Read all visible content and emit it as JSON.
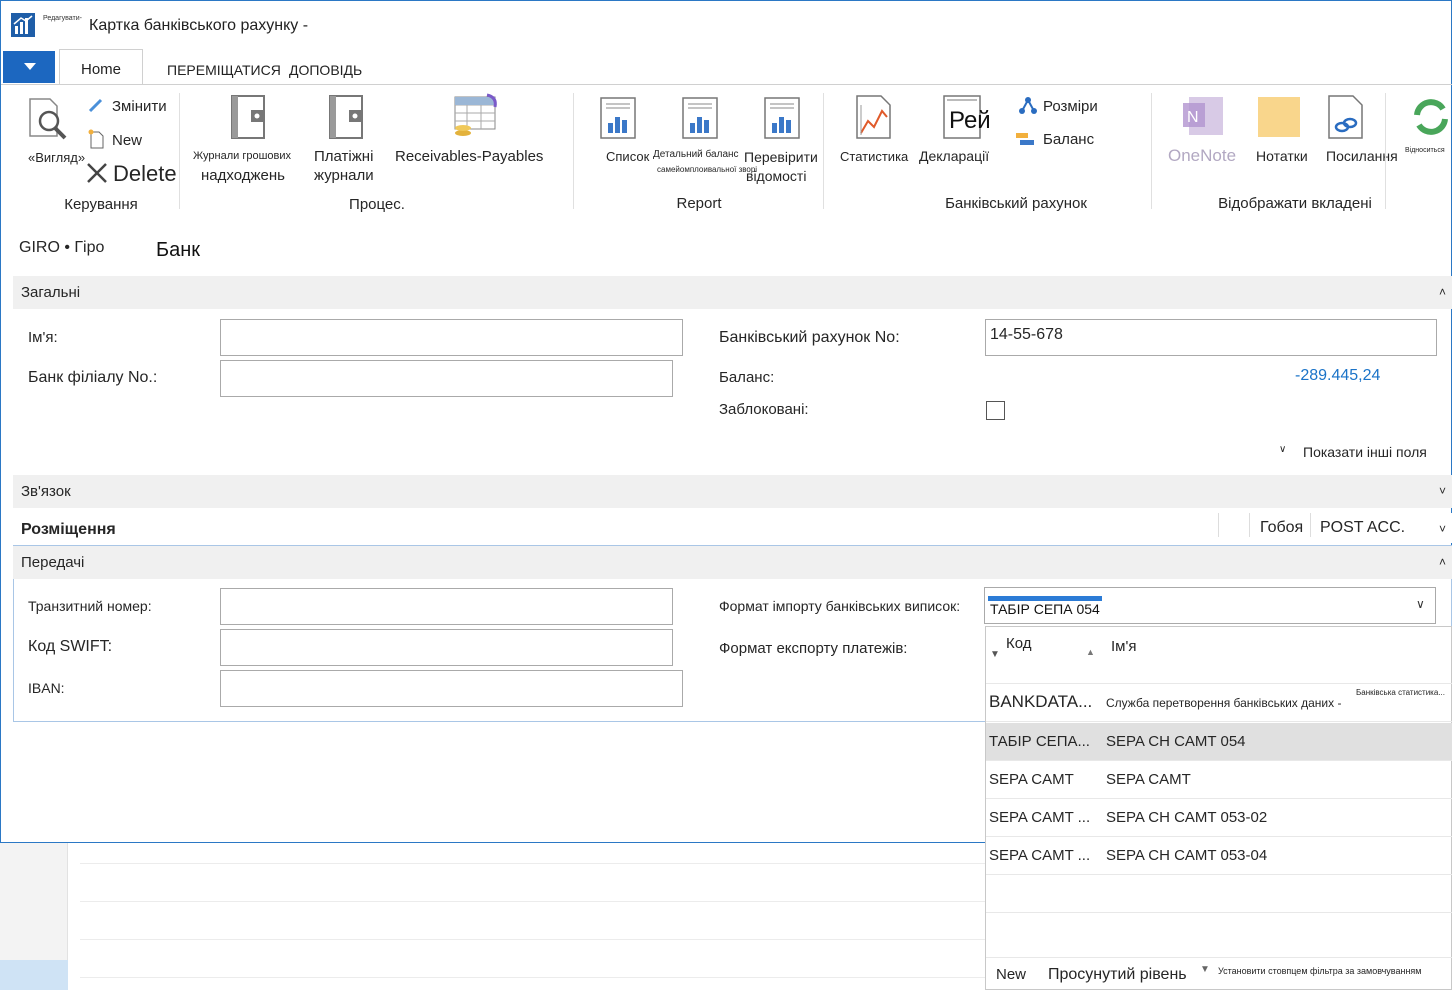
{
  "window": {
    "title": "Картка банківського рахунку -",
    "edit_tag": "Редагувати-"
  },
  "tabs": {
    "home": "Home",
    "navigate": "ПЕРЕМІЩАТИСЯ",
    "report": "ДОПОВІДЬ"
  },
  "ribbon": {
    "view": "«Вигляд»",
    "edit": "Змінити",
    "new": "New",
    "delete": "Delete",
    "group_manage": "Керування",
    "cash_receipt_line1": "Журнали грошових",
    "cash_receipt_line2": "надходжень",
    "payment_line1": "Платіжні",
    "payment_line2": "журнали",
    "receivables_payables": "Receivables-Payables",
    "group_process": "Процес.",
    "list": "Список",
    "detail_trial_line1": "Детальний баланс",
    "detail_trial_line2": "самейомплоивальної зворі",
    "check_line1": "Перевірити",
    "check_line2": "відомості",
    "group_report": "Report",
    "statistics": "Статистика",
    "rei": "Рей",
    "statements": "Декларації",
    "dimensions": "Розміри",
    "balance": "Баланс",
    "group_bank_account": "Банківський рахунок",
    "onenote": "OneNote",
    "notes": "Нотатки",
    "links": "Посилання",
    "group_show_attached": "Відображати вкладені",
    "refresh_label": "Відноситься"
  },
  "page": {
    "code": "GIRO • Гіро",
    "name": "Банк"
  },
  "general": {
    "header": "Загальні",
    "name_label": "Ім'я:",
    "name_value": "",
    "branch_label": "Банк філіалу No.:",
    "branch_value": "",
    "account_no_label": "Банківський рахунок No:",
    "account_no_value": "14-55-678",
    "balance_label": "Баланс:",
    "balance_value": "-289.445,24",
    "blocked_label": "Заблоковані:",
    "show_more": "Показати інші поля"
  },
  "communication": {
    "header": "Зв'язок"
  },
  "posting": {
    "header": "Розміщення",
    "currency": "Гобоя",
    "group": "POST ACC."
  },
  "transfer": {
    "header": "Передачі",
    "transit_label": "Транзитний номер:",
    "swift_label": "Код SWIFT:",
    "iban_label": "IBAN:",
    "import_label": "Формат імпорту банківських виписок:",
    "import_value": "ТАБІР СЕПА 054",
    "export_label": "Формат експорту платежів:"
  },
  "dropdown": {
    "col_code": "Код",
    "col_name": "Ім'я",
    "rows": [
      {
        "code": "BANKDATA...",
        "name": "Служба перетворення банківських даних -",
        "extra": "Банківська статистика..."
      },
      {
        "code": "ТАБІР СЕПА...",
        "name": "SEPA CH CAMT 054",
        "extra": ""
      },
      {
        "code": "SEPA CAMT",
        "name": "SEPA CAMT",
        "extra": ""
      },
      {
        "code": "SEPA CAMT ...",
        "name": "SEPA CH CAMT 053-02",
        "extra": ""
      },
      {
        "code": "SEPA CAMT ...",
        "name": "SEPA CH CAMT 053-04",
        "extra": ""
      }
    ],
    "footer_new": "New",
    "footer_advanced": "Просунутий рівень",
    "footer_filter": "Установити стовпцем фільтра за замовчуванням"
  },
  "colors": {
    "accent": "#1c67c0",
    "value_blue": "#1a73c8",
    "section_bg": "#f0f0f0"
  }
}
